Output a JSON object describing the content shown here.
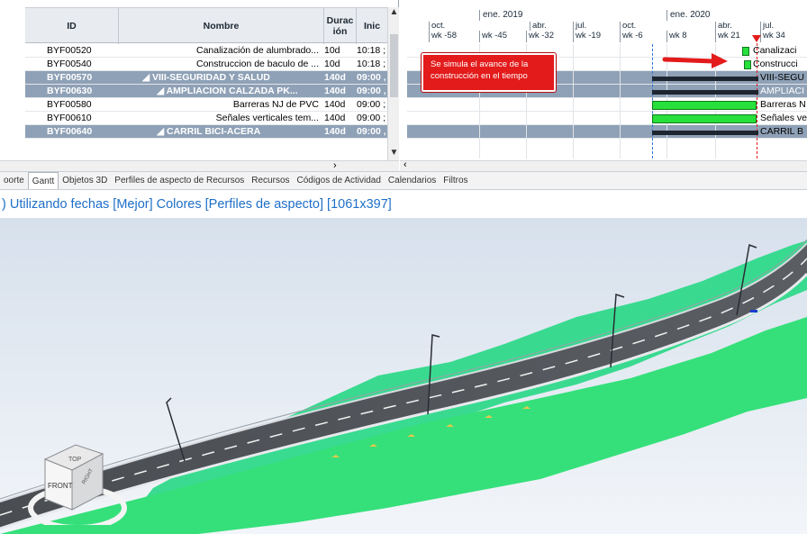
{
  "grid": {
    "columns": {
      "id": "ID",
      "name": "Nombre",
      "duration": "Durac ión",
      "start": "Inic"
    },
    "rows": [
      {
        "id": "BYF00520",
        "name": "Canalización de alumbrado...",
        "duration": "10d",
        "start": "10:18 ;",
        "summary": false
      },
      {
        "id": "BYF00540",
        "name": "Construccion de baculo de ...",
        "duration": "10d",
        "start": "10:18 ;",
        "summary": false
      },
      {
        "id": "BYF00570",
        "name": "◢ VIII-SEGURIDAD Y SALUD",
        "duration": "140d",
        "start": "09:00 ,",
        "summary": true
      },
      {
        "id": "BYF00630",
        "name": "◢ AMPLIACION CALZADA PK...",
        "duration": "140d",
        "start": "09:00 ,",
        "summary": true
      },
      {
        "id": "BYF00580",
        "name": "Barreras NJ de PVC",
        "duration": "140d",
        "start": "09:00 ;",
        "summary": false
      },
      {
        "id": "BYF00610",
        "name": "Señales verticales tem...",
        "duration": "140d",
        "start": "09:00 ;",
        "summary": false
      },
      {
        "id": "BYF00640",
        "name": "◢ CARRIL BICI-ACERA",
        "duration": "140d",
        "start": "09:00 ,",
        "summary": true
      }
    ]
  },
  "gantt": {
    "years": [
      "ene. 2019",
      "ene. 2020"
    ],
    "months": [
      "oct.",
      "abr.",
      "jul.",
      "oct.",
      "abr.",
      "jul."
    ],
    "weeks": [
      "wk -58",
      "wk -45",
      "wk -32",
      "wk -19",
      "wk -6",
      "wk 8",
      "wk 21",
      "wk 34"
    ],
    "bar_labels": [
      "Canalizaci",
      "Construcci",
      "VIII-SEGU",
      "AMPLIACI",
      "Barreras N",
      "Señales ve",
      "CARRIL B"
    ],
    "annotation": "Se simula el avance de la construcción en el tiempo",
    "colors": {
      "task_bar": "#27e03c",
      "summary_row": "#8fa1b6",
      "annotation": "#e31b1b",
      "today_marker": "#e31b1b"
    }
  },
  "tabs": [
    "oorte",
    "Gantt",
    "Objetos 3D",
    "Perfiles de aspecto de Recursos",
    "Recursos",
    "Códigos de Actividad",
    "Calendarios",
    "Filtros"
  ],
  "active_tab": "Gantt",
  "view": {
    "title": ") Utilizando fechas [Mejor] Colores [Perfiles de aspecto] [1061x397]",
    "navcube": {
      "top": "TOP",
      "front": "FRONT",
      "right": "RIGHT"
    }
  },
  "icons": [
    "scroll-up-icon",
    "scroll-down-icon",
    "scroll-right-icon",
    "scroll-left-icon",
    "collapse-triangle-icon",
    "arrow-right-icon",
    "navcube-icon"
  ]
}
